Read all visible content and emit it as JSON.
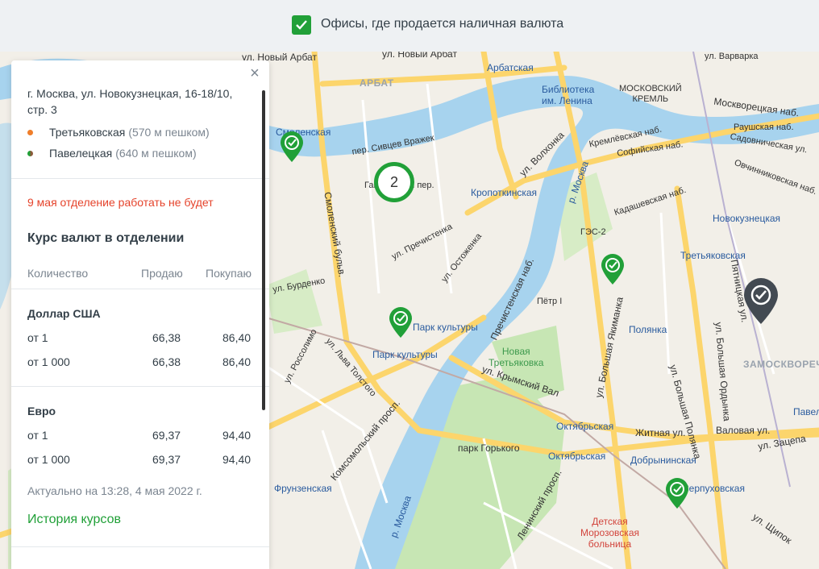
{
  "filter": {
    "label": "Офисы, где продается наличная валюта",
    "checked": true
  },
  "office": {
    "address": "г. Москва, ул. Новокузнецкая, 16-18/10, стр. 3",
    "stations": [
      {
        "name": "Третьяковская",
        "distance": "(570 м пешком)",
        "color": "#f07e2a"
      },
      {
        "name": "Павелецкая",
        "distance": "(640 м пешком)",
        "color": "#8a5a3a"
      }
    ],
    "notice": "9 мая отделение работать не будет",
    "rates_title": "Курс валют в отделении",
    "headers": {
      "qty": "Количество",
      "sell": "Продаю",
      "buy": "Покупаю"
    },
    "currencies": [
      {
        "name": "Доллар США",
        "rows": [
          {
            "qty": "от 1",
            "sell": "66,38",
            "buy": "86,40"
          },
          {
            "qty": "от 1 000",
            "sell": "66,38",
            "buy": "86,40"
          }
        ]
      },
      {
        "name": "Евро",
        "rows": [
          {
            "qty": "от 1",
            "sell": "69,37",
            "buy": "94,40"
          },
          {
            "qty": "от 1 000",
            "sell": "69,37",
            "buy": "94,40"
          }
        ]
      }
    ],
    "updated": "Актуально на 13:28, 4 мая 2022 г.",
    "history_link": "История курсов",
    "close_icon": "×"
  },
  "map": {
    "cluster_count": "2",
    "labels": {
      "novy_arbat": "ул. Новый Арбат",
      "novy_arbat2": "ул. Новый Арбат",
      "arbat_district": "АРБАТ",
      "arbatskaya": "Арбатская",
      "library": "Библиотека\nим. Ленина",
      "kremlin": "МОСКОВСКИЙ\nКРЕМЛЬ",
      "varvarka": "ул. Варварка",
      "smolenskaya": "Смоленская",
      "kropotkinskaya": "Кропоткинская",
      "moskvoretskaya": "Москворецкая наб.",
      "kremlevskaya": "Кремлёвская наб.",
      "sofiyskaya": "Софийская наб.",
      "rauschskaya": "Раушская наб.",
      "sadovnicheskaya": "Садовническая ул.",
      "ovchinnikovskaya": "Овчинниковская наб.",
      "kadashevskaya": "Кадашевская наб.",
      "novokuznetskaya": "Новокузнецкая",
      "tretyakovskaya": "Третьяковская",
      "ges2": "ГЭС-2",
      "petr1": "Пётр I",
      "polyanka": "Полянка",
      "park_kultury": "Парк культуры",
      "park_kultury2": "Парк культуры",
      "new_tretyakovka": "Новая\nТретьяковка",
      "krymsky_val": "ул. Крымский Вал",
      "oktyabrskaya": "Октябрьская",
      "oktyabrskaya2": "Октябрьская",
      "zhitnaya": "Житная ул.",
      "valovaya": "Валовая ул.",
      "dobryninskaya": "Добрынинская",
      "serpukhovskaya": "Серпуховская",
      "zamoskvorechye": "ЗАМОСКВОРЕЧЬЕ",
      "gorky_park": "парк Горького",
      "frunzenskaya": "Фрунзенская",
      "childrens_hospital": "Детская\nМорозовская\nбольница",
      "prechistenka": "ул. Пречистенка",
      "ostozhenka": "ул. Остоженка",
      "burdenko": "ул. Бурденко",
      "rossolimo": "ул. Россолимо",
      "lva_tolstogo": "ул. Льва Толстого",
      "komsomolsky": "Комсомольский просп.",
      "leninsky": "Ленинский просп.",
      "moskva_river": "р. Москва",
      "moskva_river2": "р. Москва",
      "gagarinsky": "Гагаринский пер.",
      "sivtsev": "пер. Сивцев Вражек",
      "smolensky_blvd": "Смоленский бульв.",
      "prechistenskaya": "Пречистенская наб.",
      "b_yakimanka": "ул. Большая Якиманка",
      "b_polyanka": "ул. Большая Полянка",
      "b_ordynka": "ул. Большая Ордынка",
      "pyatnitskaya": "Пятницкая ул.",
      "volkhonka": "ул. Волхонка",
      "zatsepa": "ул. Зацепа",
      "shchipok": "ул. Щипок",
      "paveletskaya_short": "Павел"
    }
  },
  "colors": {
    "accent": "#21a038",
    "metro_red": "#d2453d",
    "river": "#a7d3ee",
    "road": "#fcd56c",
    "park": "#c7e6b4"
  }
}
